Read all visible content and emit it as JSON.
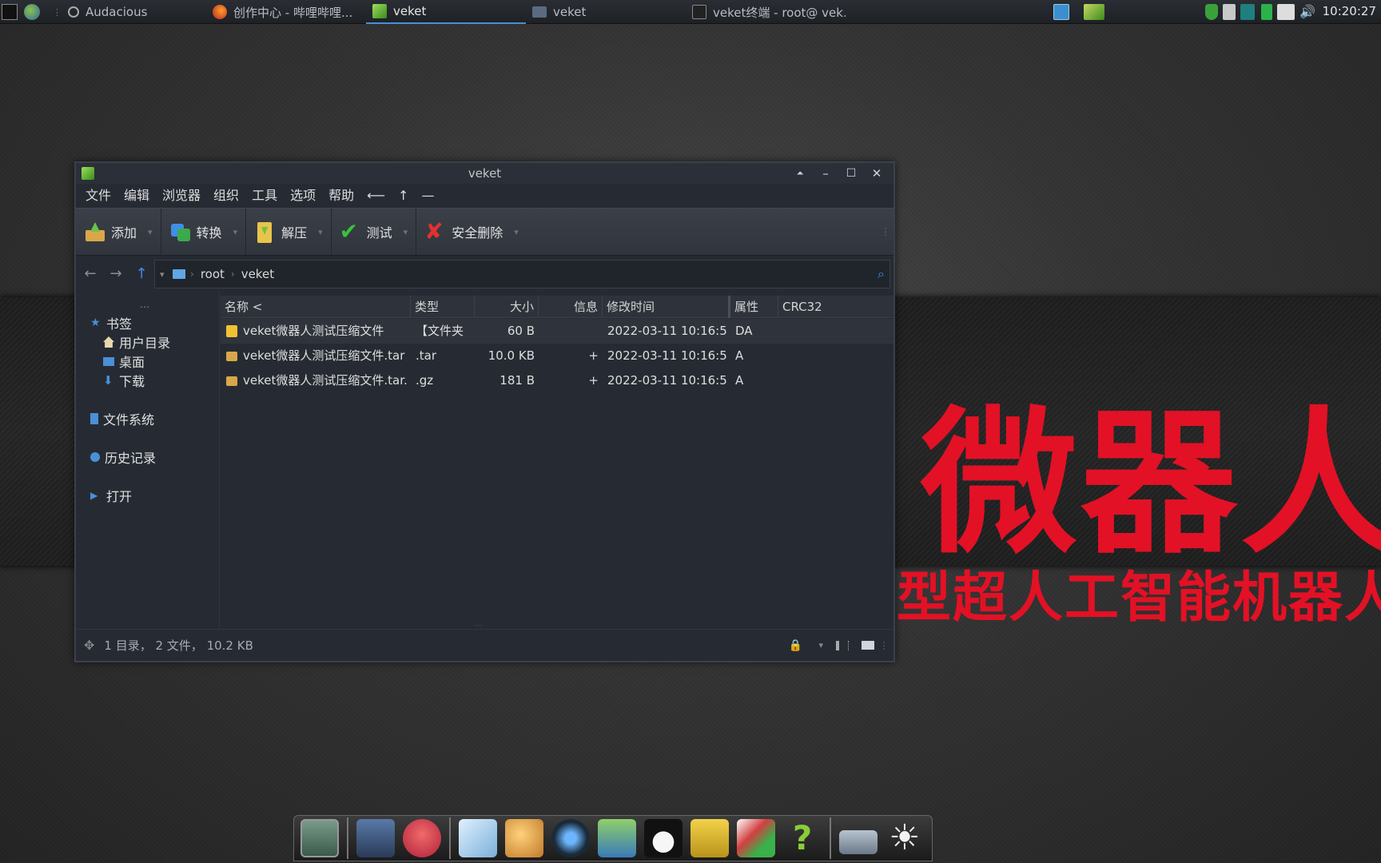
{
  "taskbar": {
    "tasks": [
      {
        "label": "Audacious",
        "icon": "audacious-icon"
      },
      {
        "label": "创作中心 - 哔哩哔哩...",
        "icon": "firefox-icon"
      },
      {
        "label": "veket",
        "icon": "veket-app-icon",
        "active": true
      },
      {
        "label": "veket",
        "icon": "folder-icon"
      },
      {
        "label": "veket终端 - root@ vek…",
        "icon": "terminal-icon"
      }
    ],
    "clock": "10:20:27"
  },
  "window": {
    "title": "veket",
    "menu": [
      "文件",
      "编辑",
      "浏览器",
      "组织",
      "工具",
      "选项",
      "帮助",
      "⟵",
      "↑",
      "—"
    ],
    "toolbar": [
      {
        "label": "添加",
        "icon": "add-archive-icon"
      },
      {
        "label": "转换",
        "icon": "convert-icon"
      },
      {
        "label": "解压",
        "icon": "extract-icon"
      },
      {
        "label": "测试",
        "icon": "test-check-icon"
      },
      {
        "label": "安全删除",
        "icon": "secure-delete-icon"
      }
    ],
    "path": [
      "root",
      "veket"
    ],
    "sidebar": {
      "bookmarks": "书签",
      "bookmark_items": [
        "用户目录",
        "桌面",
        "下载"
      ],
      "filesystem": "文件系统",
      "history": "历史记录",
      "open": "打开",
      "more": "…"
    },
    "columns": [
      "名称 <",
      "类型",
      "大小",
      "信息",
      "修改时间",
      "属性",
      "CRC32"
    ],
    "files": [
      {
        "name": "veket微器人测试压缩文件",
        "type": "【文件夹",
        "size": "60 B",
        "info": "",
        "modified": "2022-03-11 10:16:5",
        "attr": "DA",
        "crc": "",
        "kind": "folder"
      },
      {
        "name": "veket微器人测试压缩文件.tar",
        "type": ".tar",
        "size": "10.0 KB",
        "info": "+",
        "modified": "2022-03-11 10:16:5",
        "attr": "A",
        "crc": "",
        "kind": "archive"
      },
      {
        "name": "veket微器人测试压缩文件.tar.",
        "type": ".gz",
        "size": "181 B",
        "info": "+",
        "modified": "2022-03-11 10:16:5",
        "attr": "A",
        "crc": "",
        "kind": "archive"
      }
    ],
    "status": "1 目录， 2 文件， 10.2 KB"
  },
  "desktop": {
    "headline": "微器人",
    "subline": "型超人工智能机器人"
  },
  "colors": {
    "accent": "#4a8fd8",
    "headline_red": "#e31125",
    "window_bg": "#262b33"
  }
}
